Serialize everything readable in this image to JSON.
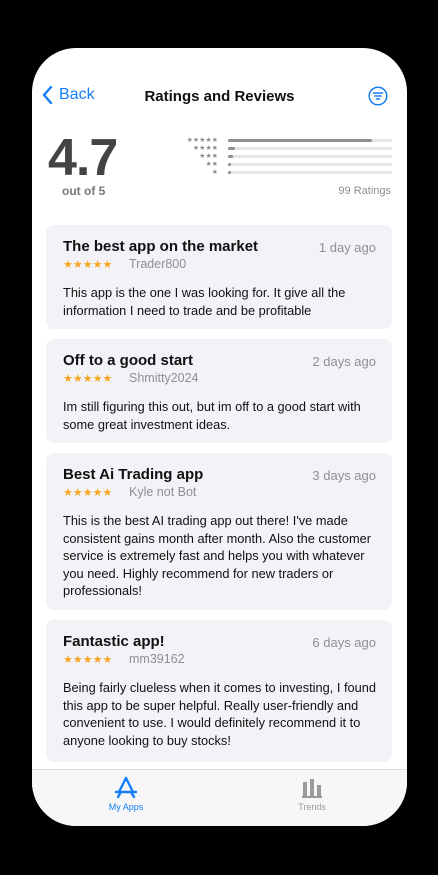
{
  "nav": {
    "back_label": "Back",
    "title": "Ratings and Reviews"
  },
  "summary": {
    "average": "4.7",
    "out_of": "out of 5",
    "ratings_count": "99 Ratings",
    "distribution": [
      {
        "stars": "★★★★★",
        "fraction": 0.88
      },
      {
        "stars": "★★★★",
        "fraction": 0.04
      },
      {
        "stars": "★★★",
        "fraction": 0.03
      },
      {
        "stars": "★★",
        "fraction": 0.02
      },
      {
        "stars": "★",
        "fraction": 0.02
      }
    ]
  },
  "reviews": [
    {
      "title": "The best app on the market",
      "date": "1 day ago",
      "stars": "★★★★★",
      "author": "Trader800",
      "body": "This app is the one I was looking for. It give all the information I need to trade and be profitable"
    },
    {
      "title": "Off to a good start",
      "date": "2 days ago",
      "stars": "★★★★★",
      "author": "Shmitty2024",
      "body": "Im still figuring this out, but im off to a good start with some great investment ideas."
    },
    {
      "title": "Best Ai Trading app",
      "date": "3 days ago",
      "stars": "★★★★★",
      "author": "Kyle not Bot",
      "body": "This is the best AI trading app out there! I've made consistent gains month after month. Also the customer service is extremely fast and helps you with whatever you need. Highly recommend for new traders or professionals!"
    },
    {
      "title": "Fantastic app!",
      "date": "6 days ago",
      "stars": "★★★★★",
      "author": "mm39162",
      "body": "Being fairly clueless when it comes to investing, I found this app to be super helpful. Really user-friendly and convenient to use. I would definitely recommend it to anyone looking to buy stocks!"
    }
  ],
  "tabs": {
    "my_apps": "My Apps",
    "trends": "Trends"
  },
  "colors": {
    "accent": "#147EFB",
    "star": "#F6A623"
  },
  "icons": {
    "back": "chevron-left-icon",
    "filter": "filter-icon",
    "my_apps": "app-store-icon",
    "trends": "bar-chart-icon"
  }
}
